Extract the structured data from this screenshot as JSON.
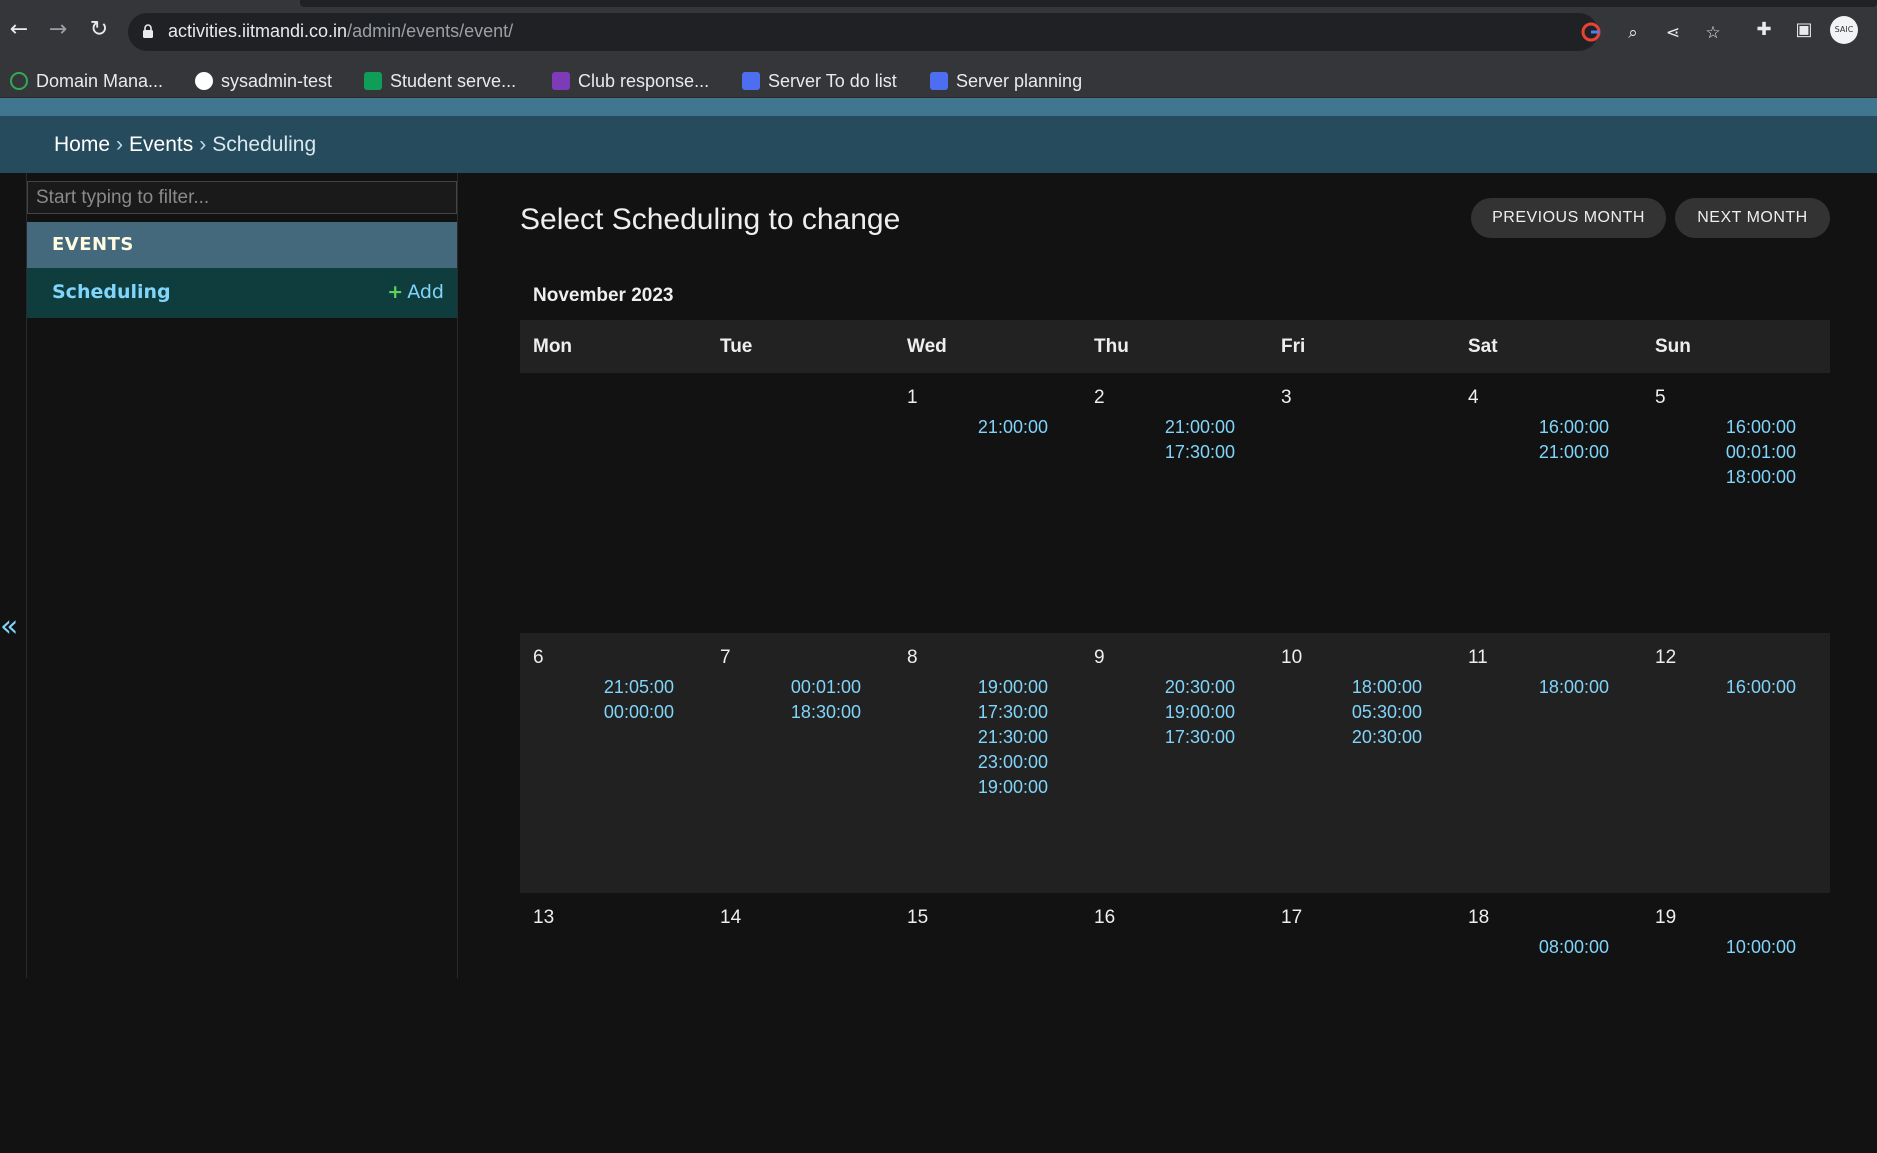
{
  "browser": {
    "url_host": "activities.iitmandi.co.in",
    "url_path": "/admin/events/event/",
    "bookmarks": [
      {
        "label": "Domain Mana...",
        "icon": "domain-icon",
        "color": "#34a853"
      },
      {
        "label": "sysadmin-test",
        "icon": "github-icon",
        "color": "#ffffff"
      },
      {
        "label": "Student serve...",
        "icon": "sheets-icon",
        "color": "#0f9d58"
      },
      {
        "label": "Club response...",
        "icon": "forms-icon",
        "color": "#7e3bb8"
      },
      {
        "label": "Server To do list",
        "icon": "docs-icon",
        "color": "#4e6ef2"
      },
      {
        "label": "Server planning",
        "icon": "docs-icon",
        "color": "#4e6ef2"
      }
    ],
    "profile_label": "SAIC"
  },
  "breadcrumbs": {
    "home": "Home",
    "sep": "›",
    "events": "Events",
    "current": "Scheduling"
  },
  "sidebar": {
    "filter_placeholder": "Start typing to filter...",
    "module_caption": "EVENTS",
    "model_label": "Scheduling",
    "add_label": "Add",
    "collapse": "«"
  },
  "content": {
    "title": "Select Scheduling to change",
    "prev_button": "PREVIOUS MONTH",
    "next_button": "NEXT MONTH",
    "month": "November 2023"
  },
  "calendar": {
    "days": [
      "Mon",
      "Tue",
      "Wed",
      "Thu",
      "Fri",
      "Sat",
      "Sun"
    ],
    "weeks": [
      [
        {
          "num": "",
          "times": []
        },
        {
          "num": "",
          "times": []
        },
        {
          "num": "1",
          "times": [
            "21:00:00"
          ]
        },
        {
          "num": "2",
          "times": [
            "21:00:00",
            "17:30:00"
          ]
        },
        {
          "num": "3",
          "times": []
        },
        {
          "num": "4",
          "times": [
            "16:00:00",
            "21:00:00"
          ]
        },
        {
          "num": "5",
          "times": [
            "16:00:00",
            "00:01:00",
            "18:00:00"
          ]
        }
      ],
      [
        {
          "num": "6",
          "times": [
            "21:05:00",
            "00:00:00"
          ]
        },
        {
          "num": "7",
          "times": [
            "00:01:00",
            "18:30:00"
          ]
        },
        {
          "num": "8",
          "times": [
            "19:00:00",
            "17:30:00",
            "21:30:00",
            "23:00:00",
            "19:00:00"
          ]
        },
        {
          "num": "9",
          "times": [
            "20:30:00",
            "19:00:00",
            "17:30:00"
          ]
        },
        {
          "num": "10",
          "times": [
            "18:00:00",
            "05:30:00",
            "20:30:00"
          ]
        },
        {
          "num": "11",
          "times": [
            "18:00:00"
          ]
        },
        {
          "num": "12",
          "times": [
            "16:00:00"
          ]
        }
      ],
      [
        {
          "num": "13",
          "times": []
        },
        {
          "num": "14",
          "times": []
        },
        {
          "num": "15",
          "times": []
        },
        {
          "num": "16",
          "times": []
        },
        {
          "num": "17",
          "times": []
        },
        {
          "num": "18",
          "times": [
            "08:00:00"
          ]
        },
        {
          "num": "19",
          "times": [
            "10:00:00"
          ]
        }
      ]
    ]
  }
}
